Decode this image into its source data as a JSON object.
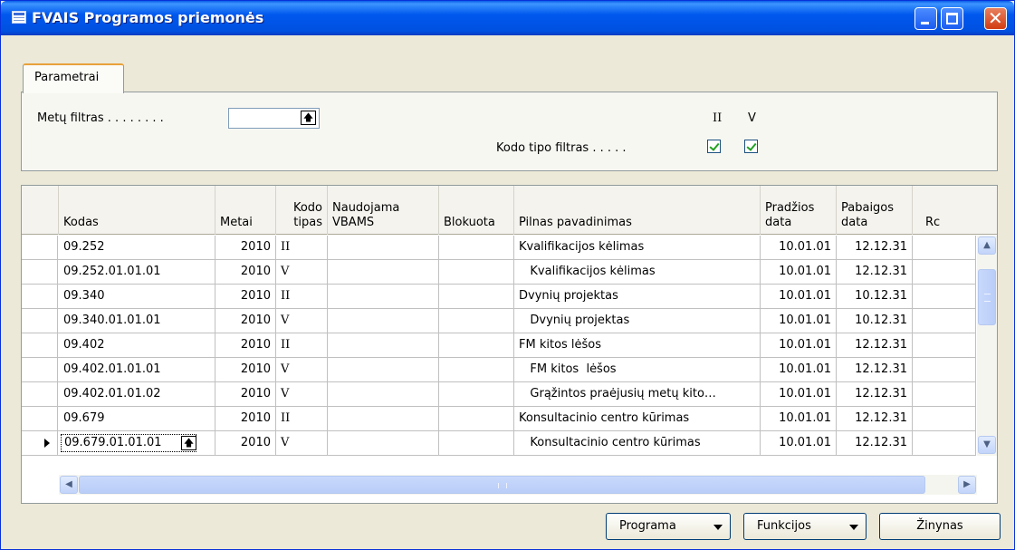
{
  "window": {
    "title": "FVAIS Programos priemonės",
    "controls": {
      "minimize": "_",
      "maximize": "□",
      "close": "✕"
    }
  },
  "tabs": [
    {
      "label": "Parametrai"
    }
  ],
  "params": {
    "year_filter_label": "Metų filtras . . . . . . . .",
    "year_filter_value": "",
    "code_type_filter_label": "Kodo tipo filtras . . . . .",
    "code_types": [
      {
        "label": "II",
        "checked": true
      },
      {
        "label": "V",
        "checked": true
      }
    ]
  },
  "table": {
    "headers": [
      "Kodas",
      "Metai",
      "Kodo\ntipas",
      "Naudojama\nVBAMS",
      "Blokuota",
      "Pilnas pavadinimas",
      "Pradžios\ndata",
      "Pabaigos\ndata",
      "Rc"
    ],
    "rows": [
      {
        "kodas": "09.252",
        "metai": "2010",
        "tipas": "II",
        "naudojama": "",
        "blokuota": "",
        "pavadinimas": "Kvalifikacijos kėlimas",
        "pradzia": "10.01.01",
        "pabaiga": "12.12.31"
      },
      {
        "kodas": "09.252.01.01.01",
        "metai": "2010",
        "tipas": "V",
        "naudojama": "",
        "blokuota": "",
        "pavadinimas": "   Kvalifikacijos kėlimas",
        "pradzia": "10.01.01",
        "pabaiga": "12.12.31"
      },
      {
        "kodas": "09.340",
        "metai": "2010",
        "tipas": "II",
        "naudojama": "",
        "blokuota": "",
        "pavadinimas": "Dvynių projektas",
        "pradzia": "10.01.01",
        "pabaiga": "10.12.31"
      },
      {
        "kodas": "09.340.01.01.01",
        "metai": "2010",
        "tipas": "V",
        "naudojama": "",
        "blokuota": "",
        "pavadinimas": "   Dvynių projektas",
        "pradzia": "10.01.01",
        "pabaiga": "10.12.31"
      },
      {
        "kodas": "09.402",
        "metai": "2010",
        "tipas": "II",
        "naudojama": "",
        "blokuota": "",
        "pavadinimas": "FM kitos lėšos",
        "pradzia": "10.01.01",
        "pabaiga": "12.12.31"
      },
      {
        "kodas": "09.402.01.01.01",
        "metai": "2010",
        "tipas": "V",
        "naudojama": "",
        "blokuota": "",
        "pavadinimas": "   FM kitos  lėšos",
        "pradzia": "10.01.01",
        "pabaiga": "12.12.31"
      },
      {
        "kodas": "09.402.01.01.02",
        "metai": "2010",
        "tipas": "V",
        "naudojama": "",
        "blokuota": "",
        "pavadinimas": "   Grąžintos praėjusių metų kito…",
        "pradzia": "10.01.01",
        "pabaiga": "12.12.31"
      },
      {
        "kodas": "09.679",
        "metai": "2010",
        "tipas": "II",
        "naudojama": "",
        "blokuota": "",
        "pavadinimas": "Konsultacinio centro kūrimas",
        "pradzia": "10.01.01",
        "pabaiga": "12.12.31"
      },
      {
        "kodas": "09.679.01.01.01",
        "metai": "2010",
        "tipas": "V",
        "naudojama": "",
        "blokuota": "",
        "pavadinimas": "   Konsultacinio centro kūrimas",
        "pradzia": "10.01.01",
        "pabaiga": "12.12.31"
      }
    ],
    "selected_row": 8
  },
  "buttons": {
    "programa": "Programa",
    "funkcijos": "Funkcijos",
    "zinynas": "Žinynas"
  }
}
